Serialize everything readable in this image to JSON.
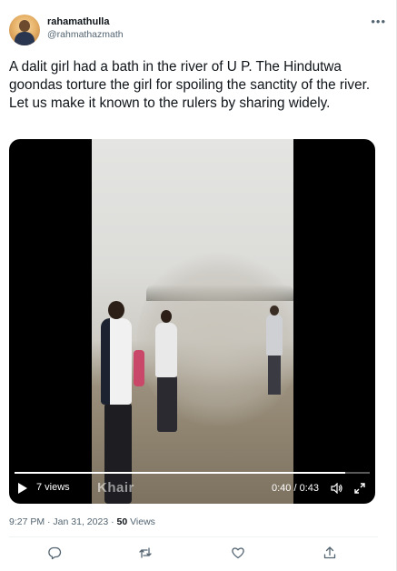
{
  "author": {
    "name": "rahamathulla",
    "handle": "@rahmathazmath",
    "more_icon": "more-horizontal-icon"
  },
  "tweet": {
    "text": "A dalit girl had a bath in the river of U P. The Hindutwa goondas torture the girl for spoiling the sanctity of the river. Let us make it known to the rulers by sharing widely."
  },
  "video": {
    "views_label": "7 views",
    "watermark": "Khair",
    "time_label": "0:40 / 0:43",
    "progress_fraction": 0.93
  },
  "meta": {
    "time": "9:27 PM · Jan 31, 2023 · ",
    "views_count": "50",
    "views_suffix": " Views"
  },
  "actions": [
    {
      "icon": "reply-icon"
    },
    {
      "icon": "retweet-icon"
    },
    {
      "icon": "like-icon"
    },
    {
      "icon": "share-icon"
    }
  ]
}
